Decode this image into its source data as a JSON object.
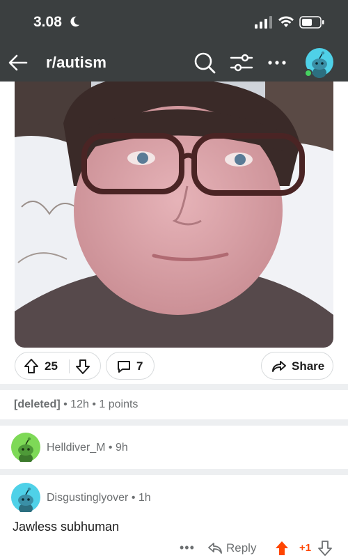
{
  "status_bar": {
    "time": "3.08",
    "icons": [
      "moon-icon",
      "signal-icon",
      "wifi-icon",
      "battery-icon"
    ]
  },
  "nav": {
    "subreddit": "r/autism",
    "icons": [
      "back-arrow-icon",
      "search-icon",
      "filter-icon",
      "more-icon",
      "profile-avatar-icon"
    ]
  },
  "post": {
    "image_alt": "Selfie of a person with glasses in front of a snowy background",
    "upvotes": "25",
    "comments": "7",
    "share_label": "Share"
  },
  "comments": [
    {
      "author": "[deleted]",
      "age": "12h",
      "points": "1 points"
    },
    {
      "author": "Helldiver_M",
      "age": "9h"
    },
    {
      "author": "Disgustinglyover",
      "age": "1h",
      "text": "Jawless subhuman",
      "score": "+1",
      "reply_label": "Reply",
      "more": "•••"
    }
  ],
  "colors": {
    "header_bg": "#3b3f40",
    "upvote_active": "#ff4500",
    "meta_text": "#6c6f71",
    "separator": "#edeff1",
    "avatar_green": "#7ed957",
    "avatar_cyan": "#4fd1e8"
  }
}
